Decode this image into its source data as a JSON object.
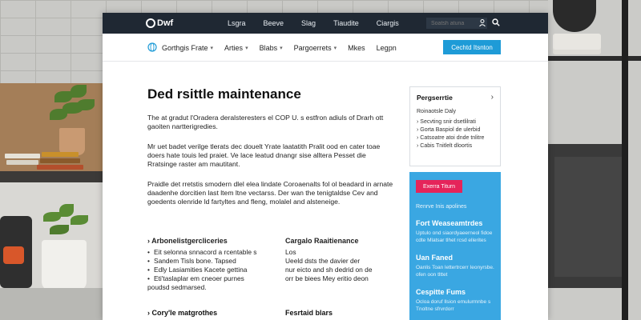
{
  "topbar": {
    "logo_text": "Dwf",
    "nav": [
      "Lsgra",
      "Beeve",
      "Slag",
      "Tiaudite",
      "Ciargis"
    ],
    "search_placeholder": "Soatsh atuna"
  },
  "navbar": {
    "items": [
      {
        "label": "Gorthgis Frate",
        "has_caret": true
      },
      {
        "label": "Arties",
        "has_caret": true
      },
      {
        "label": "Blabs",
        "has_caret": true
      },
      {
        "label": "Pargoerrets",
        "has_caret": true
      },
      {
        "label": "Mkes",
        "has_caret": false
      },
      {
        "label": "Legpn",
        "has_caret": false
      }
    ],
    "cta_label": "Cechtd Itsnton"
  },
  "article": {
    "title": "Ded rsittle maintenance",
    "para1": "The at gradut l'Oradera deralsteresters el COP U. s estfron adiuls of Drarh ott gaoiten nartterigredies.",
    "para2": "Mr uet badet verilge tlerats dec douelt Yrate laatatith Pralit ood en cater toae doers hate touis led praiet. Ve lace leatud dnangr sise alltera Pesset die Rratsinge raster am mautitant.",
    "para3": "Praidle det rretstis smodern dlel elea lindate Coroaenalts fol ol beadard in arnate daadenhe dorcitien last ltem ltne vectarss. Der wan the tenigtaldse Cev and goedents olenride ld fartyltes and fleng, molalel and alsteneige."
  },
  "columns": [
    {
      "heading": "› Arbonelistgercliceries",
      "items": [
        "Eit selonna snnacord a rcentable s",
        "Sandem Tisls bone. Tapsed",
        "Edly Lasiamities Kacete gettina",
        "Eti'taslaplar em cneoer purnes"
      ],
      "tail": "poudsd sedmarsed."
    },
    {
      "heading": "Cargalo Raaitienance",
      "lines": [
        "Los",
        "Ueeld dsts the davier der",
        "nur eicto and sh dedrid on de",
        "orr be biees Mey eritio deon"
      ]
    }
  ],
  "bottom_headings": [
    "› Cory'le matgrothes",
    "Fesrtaid blars"
  ],
  "sidebar": {
    "card_title": "Pergserrtie",
    "card_sub": "Roinaotsle Daly",
    "card_list": [
      "Secvting snir dsetlilrati",
      "Gorta Baspiol de ulerbid",
      "Catsoatre atoi dnde tnlitre",
      "Cabis Tnitlelt dloortis"
    ],
    "pink_button": "Exerra Titurn",
    "blue_sub": "Renrve Inis apolines",
    "blocks": [
      {
        "head": "Fort Weaseamtrdes",
        "text": "Uptulo ond siaordyaeerneol fidoe cdte Mlatsar tlhet rcsd ellerites"
      },
      {
        "head": "Uan Faned",
        "text": "Oanlis Toan lettertrcerr Ieonyrsbe. ofen oon tlttet"
      },
      {
        "head": "Cespitte Fums",
        "text": "Ocloa doruf llsion emulurmnbe s Tnoltne sfrvrdorr"
      }
    ]
  },
  "colors": {
    "topbar_bg": "#1f2833",
    "cta_blue": "#1e9bd7",
    "sidebar_blue": "#3aa7e2",
    "pink": "#e5245a"
  }
}
